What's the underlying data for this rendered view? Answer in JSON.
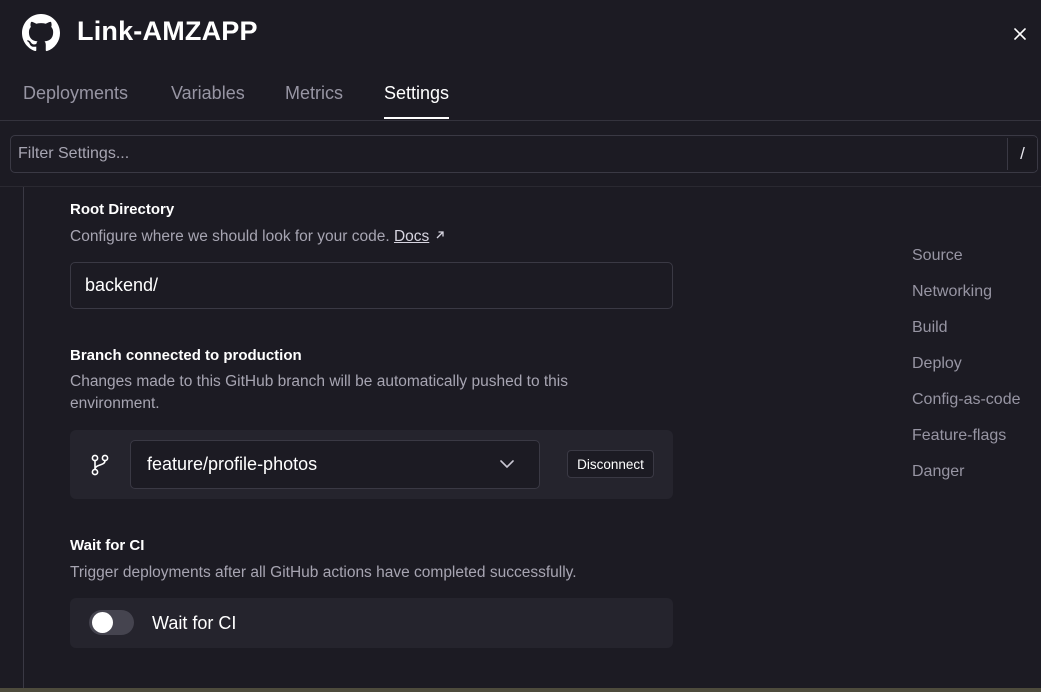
{
  "header": {
    "title": "Link-AMZAPP"
  },
  "tabs": [
    {
      "label": "Deployments",
      "active": false
    },
    {
      "label": "Variables",
      "active": false
    },
    {
      "label": "Metrics",
      "active": false
    },
    {
      "label": "Settings",
      "active": true
    }
  ],
  "filter": {
    "placeholder": "Filter Settings...",
    "shortcut": "/"
  },
  "root_directory": {
    "title": "Root Directory",
    "description": "Configure where we should look for your code.",
    "docs_label": "Docs",
    "value": "backend/"
  },
  "branch": {
    "title": "Branch connected to production",
    "description_line1": "Changes made to this GitHub branch will be automatically pushed to this",
    "description_line2": "environment.",
    "selected": "feature/profile-photos",
    "disconnect_label": "Disconnect"
  },
  "wait_for_ci": {
    "title": "Wait for CI",
    "description": "Trigger deployments after all GitHub actions have completed successfully.",
    "toggle_label": "Wait for CI",
    "enabled": false
  },
  "side_nav": [
    {
      "label": "Source"
    },
    {
      "label": "Networking"
    },
    {
      "label": "Build"
    },
    {
      "label": "Deploy"
    },
    {
      "label": "Config-as-code"
    },
    {
      "label": "Feature-flags"
    },
    {
      "label": "Danger"
    }
  ]
}
